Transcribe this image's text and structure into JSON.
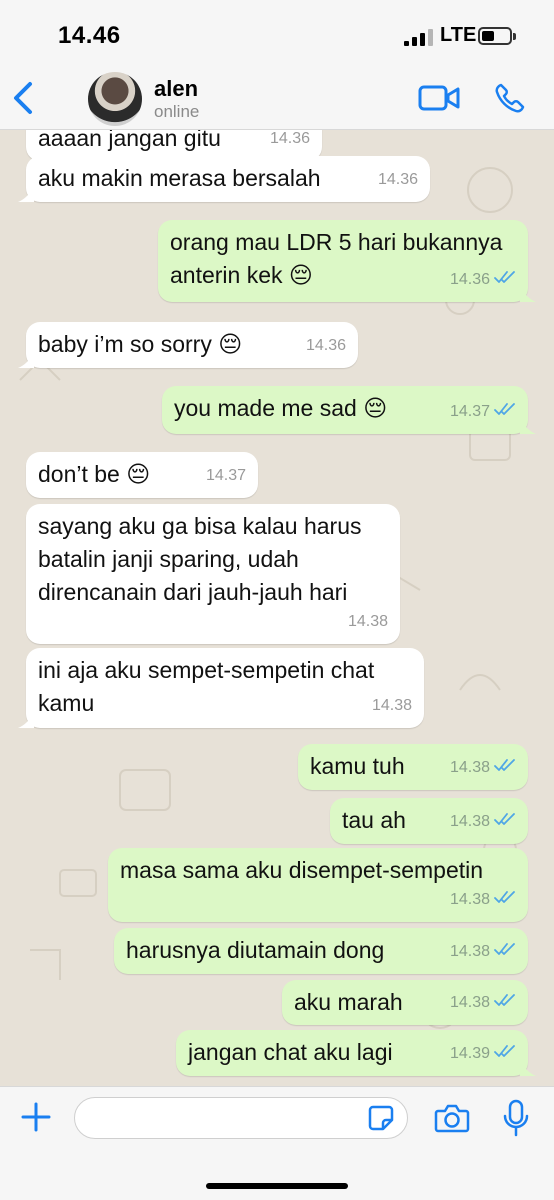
{
  "status": {
    "time": "14.46",
    "network": "LTE"
  },
  "header": {
    "name": "alen",
    "status": "online"
  },
  "messages": [
    {
      "dir": "in",
      "text": "aaaan jangan gitu",
      "time": "14.36"
    },
    {
      "dir": "in",
      "text": "aku makin merasa bersalah",
      "time": "14.36"
    },
    {
      "dir": "out",
      "text": "orang mau LDR 5 hari bukannya\nanterin kek 😔",
      "time": "14.36"
    },
    {
      "dir": "in",
      "text": "baby i’m so sorry 😔",
      "time": "14.36"
    },
    {
      "dir": "out",
      "text": "you made me sad 😔",
      "time": "14.37"
    },
    {
      "dir": "in",
      "text": "don’t be 😔",
      "time": "14.37"
    },
    {
      "dir": "in",
      "text": "sayang aku ga bisa kalau harus\nbatalin janji sparing, udah\ndirencanain dari jauh-jauh hari",
      "time": "14.38"
    },
    {
      "dir": "in",
      "text": "ini aja aku sempet-sempetin chat\nkamu",
      "time": "14.38"
    },
    {
      "dir": "out",
      "text": "kamu tuh",
      "time": "14.38"
    },
    {
      "dir": "out",
      "text": "tau ah",
      "time": "14.38"
    },
    {
      "dir": "out",
      "text": "masa sama aku disempet-sempetin",
      "time": "14.38"
    },
    {
      "dir": "out",
      "text": "harusnya diutamain dong",
      "time": "14.38"
    },
    {
      "dir": "out",
      "text": "aku marah",
      "time": "14.38"
    },
    {
      "dir": "out",
      "text": "jangan chat aku lagi",
      "time": "14.39"
    }
  ],
  "colors": {
    "accent": "#1a7ff0",
    "outgoing": "#dcf8c6",
    "incoming": "#ffffff",
    "tick": "#4fa6e6"
  },
  "icons": [
    "back-chevron-icon",
    "video-call-icon",
    "phone-call-icon",
    "plus-icon",
    "sticker-icon",
    "camera-icon",
    "microphone-icon",
    "double-check-icon"
  ]
}
